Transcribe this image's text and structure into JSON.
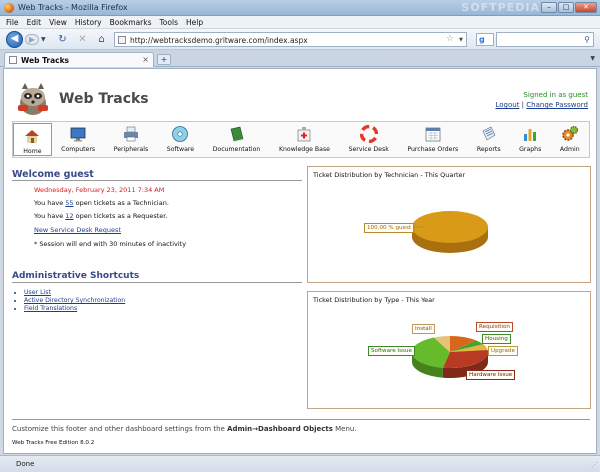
{
  "window": {
    "title": "Web Tracks - Mozilla Firefox",
    "watermark": "SOFTPEDIA"
  },
  "menu": [
    "File",
    "Edit",
    "View",
    "History",
    "Bookmarks",
    "Tools",
    "Help"
  ],
  "address": {
    "url": "http://webtracksdemo.gritware.com/index.aspx",
    "search_placeholder": ""
  },
  "tabs": [
    {
      "label": "Web Tracks"
    }
  ],
  "app": {
    "name": "Web Tracks",
    "signed_in": "Signed in as guest",
    "logout": "Logout",
    "separator": "|",
    "change_password": "Change Password"
  },
  "toolbar": [
    {
      "label": "Home",
      "icon": "house-icon",
      "selected": true
    },
    {
      "label": "Computers",
      "icon": "monitor-icon"
    },
    {
      "label": "Peripherals",
      "icon": "printer-icon"
    },
    {
      "label": "Software",
      "icon": "cd-icon"
    },
    {
      "label": "Documentation",
      "icon": "book-icon"
    },
    {
      "label": "Knowledge Base",
      "icon": "first-aid-icon"
    },
    {
      "label": "Service Desk",
      "icon": "lifebuoy-icon"
    },
    {
      "label": "Purchase Orders",
      "icon": "calendar-icon"
    },
    {
      "label": "Reports",
      "icon": "report-icon"
    },
    {
      "label": "Graphs",
      "icon": "bar-graph-icon"
    },
    {
      "label": "Admin",
      "icon": "gears-icon"
    }
  ],
  "welcome": {
    "heading": "Welcome guest",
    "date": "Wednesday, February 23, 2011 7:34 AM",
    "tech_prefix": "You have ",
    "tech_count": "55",
    "tech_suffix": " open tickets as a Technician.",
    "req_prefix": "You have ",
    "req_count": "12",
    "req_suffix": " open tickets as a Requester.",
    "new_request": "New Service Desk Request",
    "session_note": "* Session will end with 30 minutes of inactivity"
  },
  "shortcuts": {
    "heading": "Administrative Shortcuts",
    "items": [
      "User List",
      "Active Directory Synchronization",
      "Field Translations"
    ]
  },
  "chart_data": [
    {
      "type": "pie",
      "title": "Ticket Distribution by Technician - This Quarter",
      "categories": [
        "guest"
      ],
      "values": [
        100.0
      ],
      "labels": [
        "100.00 % guest"
      ],
      "colors": [
        "#d99a18"
      ]
    },
    {
      "type": "pie",
      "title": "Ticket Distribution by Type - This Year",
      "categories": [
        "Requisition",
        "Housing",
        "Upgrade",
        "Hardware Issue",
        "Software Issue",
        "Install"
      ],
      "values": [
        12,
        5,
        6,
        30,
        40,
        7
      ],
      "colors": [
        "#d9661a",
        "#4aa02c",
        "#e0b840",
        "#b83a22",
        "#66bb2a",
        "#e8c27a"
      ]
    }
  ],
  "footer": {
    "text_pre": "Customize this footer and other dashboard settings from the ",
    "bold": "Admin→Dashboard Objects",
    "text_post": " Menu.",
    "edition": "Web Tracks Free Edition 8.0.2"
  },
  "status": {
    "text": "Done"
  }
}
